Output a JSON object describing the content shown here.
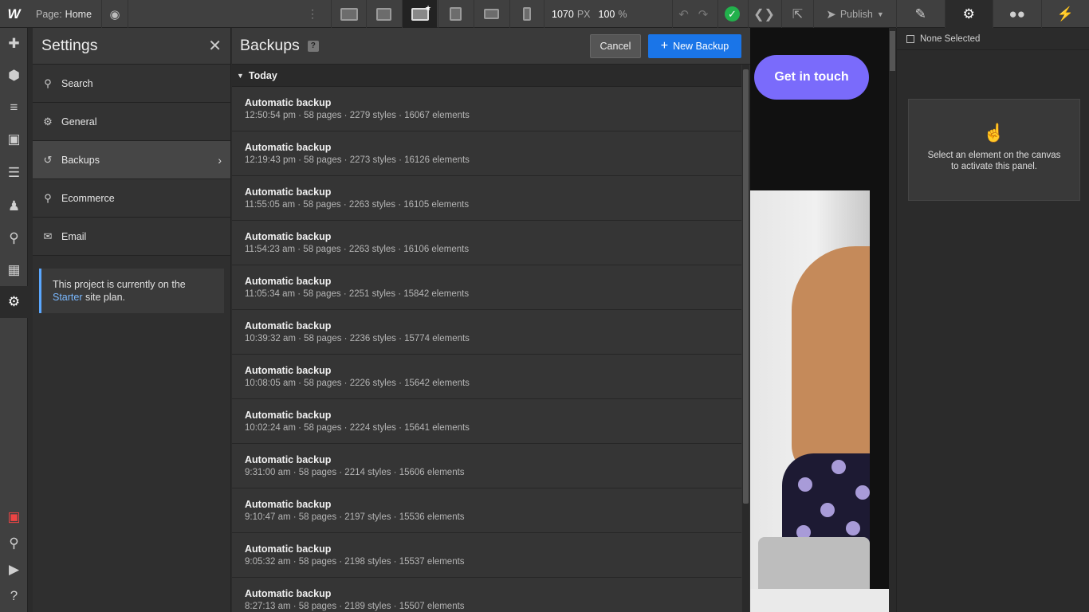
{
  "topbar": {
    "logo": "W",
    "page_prefix": "Page:",
    "page_name": "Home",
    "width_value": "1070",
    "width_unit": "PX",
    "zoom_value": "100",
    "zoom_unit": "%",
    "publish_label": "Publish"
  },
  "settings": {
    "title": "Settings",
    "nav": [
      {
        "label": "Search",
        "icon": "search-icon"
      },
      {
        "label": "General",
        "icon": "gear-icon"
      },
      {
        "label": "Backups",
        "icon": "history-icon"
      },
      {
        "label": "Ecommerce",
        "icon": "cart-icon"
      },
      {
        "label": "Email",
        "icon": "mail-icon"
      }
    ],
    "info_text_1": "This project is currently on the",
    "info_link": "Starter",
    "info_text_2": "site plan."
  },
  "backups": {
    "title": "Backups",
    "help": "?",
    "cancel_label": "Cancel",
    "new_label": "New Backup",
    "group": "Today",
    "items": [
      {
        "name": "Automatic backup",
        "meta": "12:50:54 pm · 58 pages · 2279 styles · 16067 elements"
      },
      {
        "name": "Automatic backup",
        "meta": "12:19:43 pm · 58 pages · 2273 styles · 16126 elements"
      },
      {
        "name": "Automatic backup",
        "meta": "11:55:05 am · 58 pages · 2263 styles · 16105 elements"
      },
      {
        "name": "Automatic backup",
        "meta": "11:54:23 am · 58 pages · 2263 styles · 16106 elements"
      },
      {
        "name": "Automatic backup",
        "meta": "11:05:34 am · 58 pages · 2251 styles · 15842 elements"
      },
      {
        "name": "Automatic backup",
        "meta": "10:39:32 am · 58 pages · 2236 styles · 15774 elements"
      },
      {
        "name": "Automatic backup",
        "meta": "10:08:05 am · 58 pages · 2226 styles · 15642 elements"
      },
      {
        "name": "Automatic backup",
        "meta": "10:02:24 am · 58 pages · 2224 styles · 15641 elements"
      },
      {
        "name": "Automatic backup",
        "meta": "9:31:00 am · 58 pages · 2214 styles · 15606 elements"
      },
      {
        "name": "Automatic backup",
        "meta": "9:10:47 am · 58 pages · 2197 styles · 15536 elements"
      },
      {
        "name": "Automatic backup",
        "meta": "9:05:32 am · 58 pages · 2198 styles · 15537 elements"
      },
      {
        "name": "Automatic backup",
        "meta": "8:27:13 am · 58 pages · 2189 styles · 15507 elements"
      }
    ]
  },
  "canvas": {
    "cta_label": "Get in touch",
    "accent": "#7a6bfb"
  },
  "right_panel": {
    "selection": "None Selected",
    "empty_line_1": "Select an element on the canvas",
    "empty_line_2": "to activate this panel."
  }
}
